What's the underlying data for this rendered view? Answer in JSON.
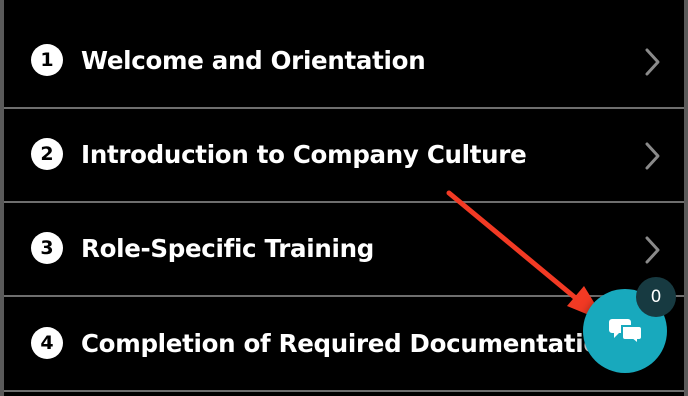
{
  "steps": [
    {
      "number": "1",
      "title": "Welcome and Orientation",
      "icon": "chevron-right-icon"
    },
    {
      "number": "2",
      "title": "Introduction to Company Culture",
      "icon": "chevron-right-icon"
    },
    {
      "number": "3",
      "title": "Role-Specific Training",
      "icon": "chevron-right-icon"
    },
    {
      "number": "4",
      "title": "Completion of Required Documentation",
      "icon": "chevron-right-icon"
    }
  ],
  "chat": {
    "icon": "chat-bubbles-icon",
    "unread_count": "0"
  },
  "annotation": {
    "icon": "red-arrow-icon",
    "color": "#f23a24"
  },
  "colors": {
    "background": "#000000",
    "row_text": "#ffffff",
    "chevron": "#8a8a8a",
    "chat_button": "#18a9bd",
    "badge": "#173a41"
  }
}
